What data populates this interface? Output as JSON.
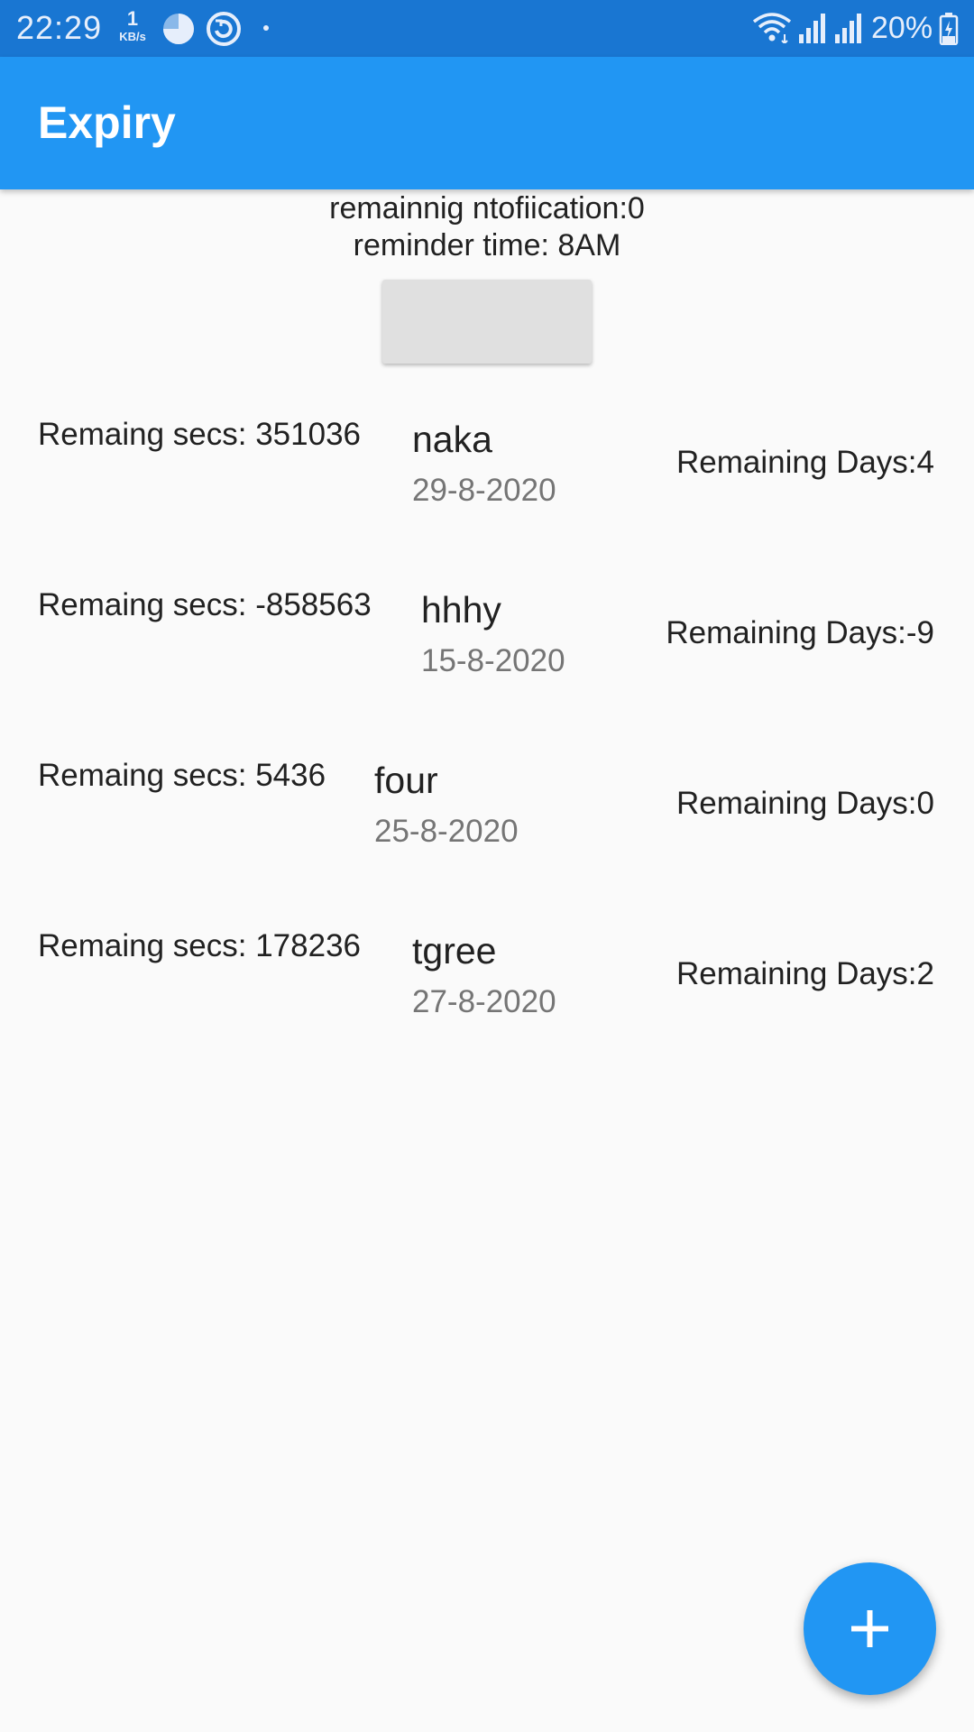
{
  "status_bar": {
    "time": "22:29",
    "net_speed_value": "1",
    "net_speed_unit": "KB/s",
    "battery": "20%",
    "icons": [
      "pie-status-icon",
      "sync-icon",
      "wifi-icon",
      "signal-icon",
      "signal-icon",
      "battery-charging-icon"
    ]
  },
  "app_bar": {
    "title": "Expiry"
  },
  "header": {
    "notifications": "remainnig ntofiication:0",
    "reminder": "reminder time: 8AM"
  },
  "items": [
    {
      "secs": "Remaing secs: 351036",
      "name": "naka",
      "date": "29-8-2020",
      "days": "Remaining Days:4"
    },
    {
      "secs": "Remaing secs: -858563",
      "name": "hhhy",
      "date": "15-8-2020",
      "days": "Remaining Days:-9"
    },
    {
      "secs": "Remaing secs: 5436",
      "name": "four",
      "date": "25-8-2020",
      "days": "Remaining Days:0"
    },
    {
      "secs": "Remaing secs: 178236",
      "name": "tgree",
      "date": "27-8-2020",
      "days": "Remaining Days:2"
    }
  ],
  "fab": {
    "icon": "plus-icon"
  },
  "colors": {
    "status_bar": "#1976d2",
    "primary": "#2196f3",
    "background": "#fafafa",
    "button": "#e0e0e0"
  }
}
